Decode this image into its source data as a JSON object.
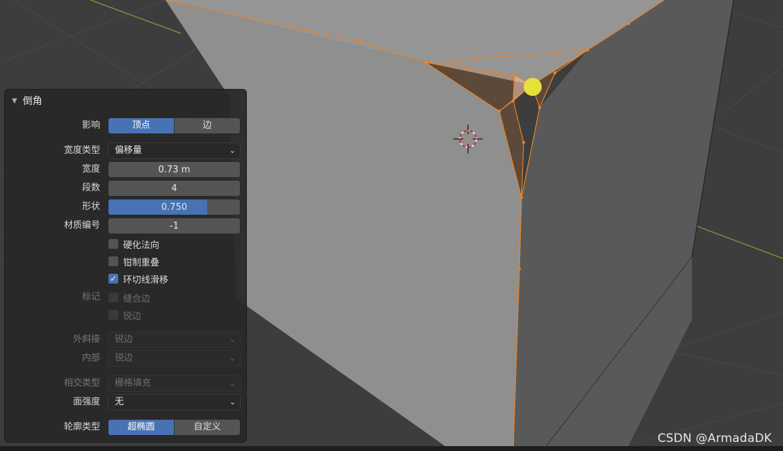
{
  "panel": {
    "title": "倒角",
    "affect": {
      "label": "影响",
      "options": [
        "顶点",
        "边"
      ],
      "selected": 0
    },
    "width_type": {
      "label": "宽度类型",
      "value": "偏移量"
    },
    "width": {
      "label": "宽度",
      "value": "0.73 m"
    },
    "segments": {
      "label": "段数",
      "value": "4"
    },
    "shape": {
      "label": "形状",
      "value": "0.750",
      "fraction": 0.75
    },
    "material": {
      "label": "材质编号",
      "value": "-1"
    },
    "harden_normals": {
      "label": "硬化法向",
      "checked": false
    },
    "clamp_overlap": {
      "label": "钳制重叠",
      "checked": false
    },
    "loop_slide": {
      "label": "环切线滑移",
      "checked": true
    },
    "mark": {
      "label": "标记",
      "seam": "缝合边",
      "sharp": "锐边"
    },
    "miter_outer": {
      "label": "外斜接",
      "value": "锐边"
    },
    "miter_inner": {
      "label": "内部",
      "value": "锐边"
    },
    "intersection_type": {
      "label": "相交类型",
      "value": "栅格填充"
    },
    "face_strength": {
      "label": "面强度",
      "value": "无"
    },
    "profile_type": {
      "label": "轮廓类型",
      "options": [
        "超椭圆",
        "自定义"
      ],
      "selected": 0
    }
  },
  "watermark": "CSDN @ArmadaDK",
  "colors": {
    "accent": "#4772b3",
    "selection": "#e8822a",
    "active_vertex": "#e6e03a"
  }
}
